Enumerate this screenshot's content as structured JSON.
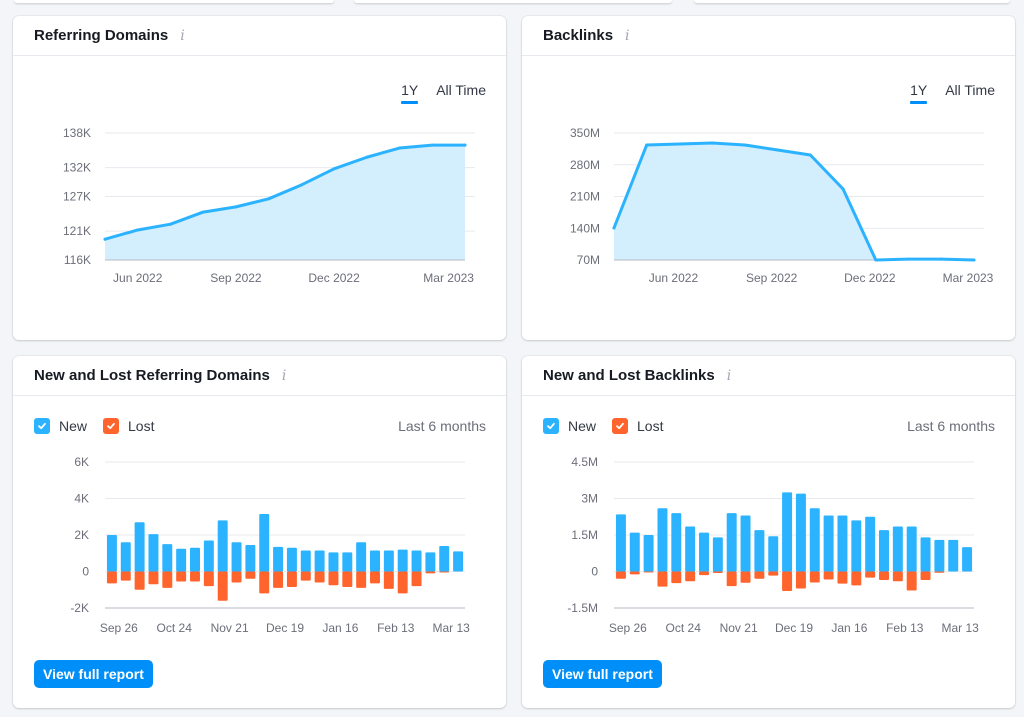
{
  "colors": {
    "line": "#2bb3ff",
    "area": "#d3eefd",
    "new": "#2bb3ff",
    "lost": "#ff642d",
    "accent": "#008ff8",
    "grid": "#e8e9ef",
    "baseline": "#b7bac5"
  },
  "cards": {
    "referring_domains": {
      "title": "Referring Domains",
      "info_icon": "i",
      "tabs": [
        {
          "label": "1Y",
          "active": true
        },
        {
          "label": "All Time",
          "active": false
        }
      ]
    },
    "backlinks": {
      "title": "Backlinks",
      "info_icon": "i",
      "tabs": [
        {
          "label": "1Y",
          "active": true
        },
        {
          "label": "All Time",
          "active": false
        }
      ]
    },
    "new_lost_referring_domains": {
      "title": "New and Lost Referring Domains",
      "info_icon": "i",
      "legend": [
        {
          "label": "New",
          "checked": true
        },
        {
          "label": "Lost",
          "checked": true
        }
      ],
      "period": "Last 6 months",
      "button": "View full report"
    },
    "new_lost_backlinks": {
      "title": "New and Lost Backlinks",
      "info_icon": "i",
      "legend": [
        {
          "label": "New",
          "checked": true
        },
        {
          "label": "Lost",
          "checked": true
        }
      ],
      "period": "Last 6 months",
      "button": "View full report"
    }
  },
  "chart_data": [
    {
      "id": "referring_domains",
      "type": "area",
      "title": "Referring Domains",
      "xlabel": "",
      "ylabel": "",
      "x_points": 12,
      "x_ticks": [
        {
          "index": 1,
          "label": "Jun 2022"
        },
        {
          "index": 4,
          "label": "Sep 2022"
        },
        {
          "index": 7,
          "label": "Dec 2022"
        },
        {
          "index": 10.5,
          "label": "Mar 2023"
        }
      ],
      "y_ticks": [
        116,
        121,
        127,
        132,
        138
      ],
      "y_tick_labels": [
        "116K",
        "121K",
        "127K",
        "132K",
        "138K"
      ],
      "ylim": [
        116,
        138
      ],
      "unit": "K",
      "values": [
        119.6,
        121.2,
        122.2,
        124.3,
        125.2,
        126.6,
        129.0,
        131.8,
        133.8,
        135.4,
        135.9,
        135.9
      ],
      "grid": true
    },
    {
      "id": "backlinks",
      "type": "area",
      "title": "Backlinks",
      "xlabel": "",
      "ylabel": "",
      "x_points": 12,
      "x_ticks": [
        {
          "index": 2,
          "label": "Jun 2022"
        },
        {
          "index": 5,
          "label": "Sep 2022"
        },
        {
          "index": 8,
          "label": "Dec 2022"
        },
        {
          "index": 11,
          "label": "Mar 2023"
        }
      ],
      "y_ticks": [
        70,
        140,
        210,
        280,
        350
      ],
      "y_tick_labels": [
        "70M",
        "140M",
        "210M",
        "280M",
        "350M"
      ],
      "ylim": [
        70,
        350
      ],
      "unit": "M",
      "values": [
        140.6,
        323.6,
        325.8,
        328.0,
        323.6,
        312.5,
        301.5,
        226.5,
        70,
        72,
        72,
        70
      ],
      "grid": true
    },
    {
      "id": "new_lost_referring_domains",
      "type": "bar",
      "title": "New and Lost Referring Domains",
      "x_ticks": [
        {
          "index": 0.5,
          "label": "Sep 26"
        },
        {
          "index": 4.5,
          "label": "Oct 24"
        },
        {
          "index": 8.5,
          "label": "Nov 21"
        },
        {
          "index": 12.5,
          "label": "Dec 19"
        },
        {
          "index": 16.5,
          "label": "Jan 16"
        },
        {
          "index": 20.5,
          "label": "Feb 13"
        },
        {
          "index": 24.5,
          "label": "Mar 13"
        }
      ],
      "y_ticks": [
        -2,
        0,
        2,
        4,
        6
      ],
      "y_tick_labels": [
        "-2K",
        "0",
        "2K",
        "4K",
        "6K"
      ],
      "ylim": [
        -2,
        6
      ],
      "unit": "K",
      "legend": "top-left",
      "series": [
        {
          "name": "New",
          "values": [
            2.0,
            1.6,
            2.7,
            2.05,
            1.5,
            1.25,
            1.3,
            1.7,
            2.8,
            1.6,
            1.45,
            3.15,
            1.35,
            1.3,
            1.15,
            1.15,
            1.05,
            1.05,
            1.6,
            1.15,
            1.15,
            1.2,
            1.15,
            1.05,
            1.4,
            1.1
          ]
        },
        {
          "name": "Lost",
          "values": [
            -0.65,
            -0.5,
            -1.0,
            -0.7,
            -0.9,
            -0.55,
            -0.55,
            -0.8,
            -1.6,
            -0.6,
            -0.4,
            -1.2,
            -0.9,
            -0.85,
            -0.5,
            -0.6,
            -0.75,
            -0.85,
            -0.9,
            -0.65,
            -0.95,
            -1.2,
            -0.8,
            -0.1,
            -0.05,
            0
          ]
        }
      ],
      "grid": true
    },
    {
      "id": "new_lost_backlinks",
      "type": "bar",
      "title": "New and Lost Backlinks",
      "x_ticks": [
        {
          "index": 0.5,
          "label": "Sep 26"
        },
        {
          "index": 4.5,
          "label": "Oct 24"
        },
        {
          "index": 8.5,
          "label": "Nov 21"
        },
        {
          "index": 12.5,
          "label": "Dec 19"
        },
        {
          "index": 16.5,
          "label": "Jan 16"
        },
        {
          "index": 20.5,
          "label": "Feb 13"
        },
        {
          "index": 24.5,
          "label": "Mar 13"
        }
      ],
      "y_ticks": [
        -1.5,
        0,
        1.5,
        3,
        4.5
      ],
      "y_tick_labels": [
        "-1.5M",
        "0",
        "1.5M",
        "3M",
        "4.5M"
      ],
      "ylim": [
        -1.5,
        4.5
      ],
      "unit": "M",
      "legend": "top-left",
      "series": [
        {
          "name": "New",
          "values": [
            2.35,
            1.6,
            1.5,
            2.6,
            2.4,
            1.85,
            1.6,
            1.4,
            2.4,
            2.3,
            1.7,
            1.45,
            3.25,
            3.2,
            2.6,
            2.3,
            2.3,
            2.1,
            2.25,
            1.7,
            1.85,
            1.85,
            1.4,
            1.3,
            1.3,
            1.0
          ]
        },
        {
          "name": "Lost",
          "values": [
            -0.3,
            -0.12,
            -0.04,
            -0.62,
            -0.48,
            -0.4,
            -0.15,
            -0.06,
            -0.6,
            -0.46,
            -0.3,
            -0.17,
            -0.8,
            -0.7,
            -0.45,
            -0.33,
            -0.5,
            -0.57,
            -0.25,
            -0.35,
            -0.4,
            -0.78,
            -0.35,
            -0.05,
            0,
            0
          ]
        }
      ],
      "grid": true
    }
  ]
}
